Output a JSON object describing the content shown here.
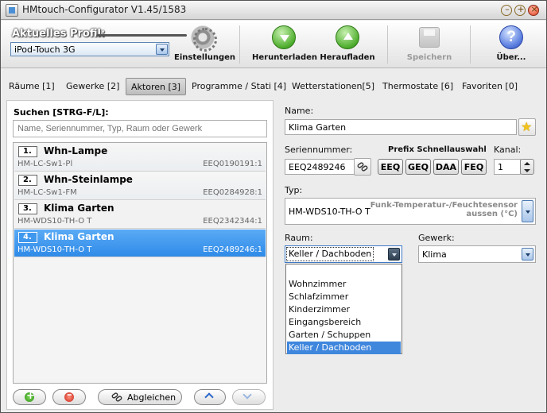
{
  "window": {
    "title": "HMtouch-Configurator V1.45/1583"
  },
  "toolbar": {
    "profile_label": "Aktuelles Profil:",
    "profile_value": "iPod-Touch 3G",
    "buttons": {
      "settings": "Einstellungen",
      "download": "Herunterladen",
      "upload": "Heraufladen",
      "save": "Speichern",
      "about": "Über..."
    }
  },
  "tabs": [
    {
      "label": "Räume [1]"
    },
    {
      "label": "Gewerke [2]"
    },
    {
      "label": "Aktoren [3]"
    },
    {
      "label": "Programme / Stati [4]"
    },
    {
      "label": "Wetterstationen[5]"
    },
    {
      "label": "Thermostate [6]"
    },
    {
      "label": "Favoriten [0]"
    }
  ],
  "active_tab": "Aktoren [3]",
  "search": {
    "label": "Suchen [STRG-F/L]:",
    "placeholder": "Name, Seriennummer, Typ, Raum oder Gewerk"
  },
  "list": {
    "items": [
      {
        "num": "1.",
        "name": "Whn-Lampe",
        "type": "HM-LC-Sw1-Pl",
        "serial": "EEQ0190191:1"
      },
      {
        "num": "2.",
        "name": "Whn-Steinlampe",
        "type": "HM-LC-Sw1-FM",
        "serial": "EEQ0284928:1"
      },
      {
        "num": "3.",
        "name": "Klima Garten",
        "type": "HM-WDS10-TH-O T",
        "serial": "EEQ2342344:1"
      },
      {
        "num": "4.",
        "name": "Klima Garten",
        "type": "HM-WDS10-TH-O T",
        "serial": "EEQ2489246:1"
      }
    ],
    "selected_index": 3
  },
  "bottom": {
    "sync_label": "Abgleichen"
  },
  "details": {
    "name_label": "Name:",
    "name_value": "Klima Garten",
    "serial_label": "Seriennummer:",
    "serial_value": "EEQ2489246",
    "prefix_label": "Prefix Schnellauswahl",
    "prefix_buttons": [
      "EEQ",
      "GEQ",
      "DAA",
      "FEQ"
    ],
    "channel_label": "Kanal:",
    "channel_value": "1",
    "type_label": "Typ:",
    "type_value": "HM-WDS10-TH-O T",
    "type_desc_line1": "Funk-Temperatur-/Feuchtesensor",
    "type_desc_line2": "aussen (°C)",
    "room_label": "Raum:",
    "room_value": "Keller / Dachboden",
    "trade_label": "Gewerk:",
    "trade_value": "Klima",
    "room_options": [
      "",
      "Wohnzimmer",
      "Schlafzimmer",
      "Kinderzimmer",
      "Eingangsbereich",
      "Garten / Schuppen",
      "Keller / Dachboden"
    ],
    "room_selected_index": 6
  },
  "colors": {
    "selection": "#3f97ee",
    "accent_green": "#4fae2e",
    "accent_red": "#c8261a"
  }
}
